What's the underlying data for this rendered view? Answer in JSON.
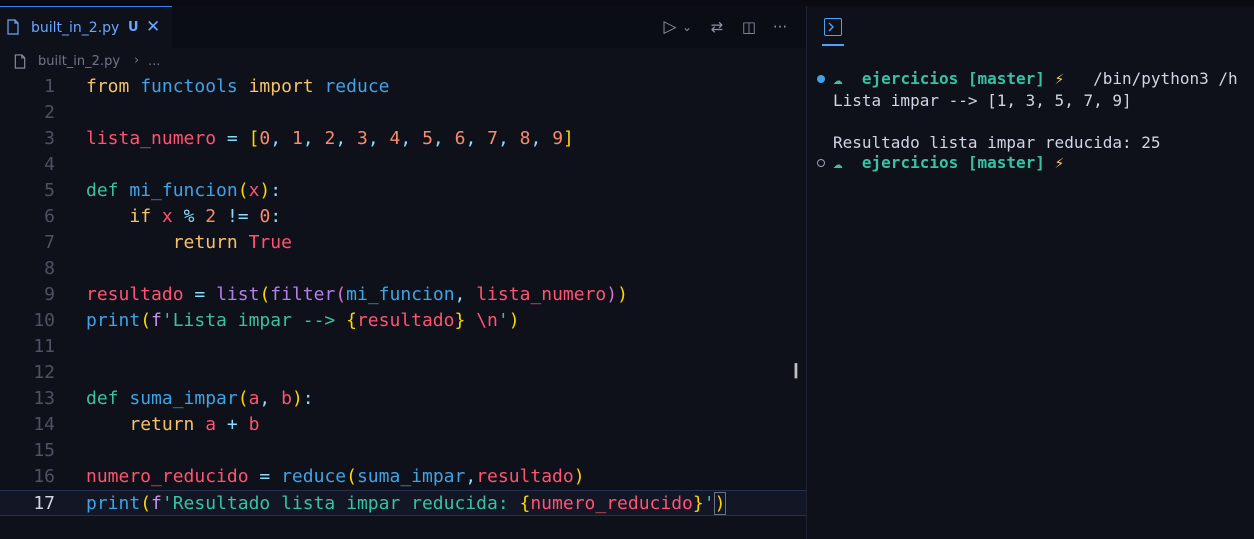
{
  "tab": {
    "filename": "built_in_2.py",
    "badge": "U",
    "close": "✕"
  },
  "toolbar": {
    "run": "▷",
    "run_dropdown": "⌄",
    "compare": "⇄",
    "split": "◫",
    "more": "···"
  },
  "breadcrumb": {
    "file": "built_in_2.py",
    "separator": "›",
    "more": "..."
  },
  "code": {
    "line_numbers": [
      "1",
      "2",
      "3",
      "4",
      "5",
      "6",
      "7",
      "8",
      "9",
      "10",
      "11",
      "12",
      "13",
      "14",
      "15",
      "16",
      "17"
    ],
    "active_line": "17"
  },
  "terminal": {
    "icon": "terminal-icon",
    "prompt_dir": "ejercicios",
    "prompt_branch": "[master]",
    "prompt_bolt": "⚡",
    "command": "/bin/python3 /h",
    "output_line1": "Lista impar --> [1, 3, 5, 7, 9]",
    "output_line2": "Resultado lista impar reducida: 25",
    "cloud_glyph": "☁"
  },
  "colors": {
    "background": "#0f111a",
    "accent": "#3b82f6",
    "keyword": "#c792ea",
    "string": "#c3e88d",
    "terminal_green": "#38c2a3"
  }
}
